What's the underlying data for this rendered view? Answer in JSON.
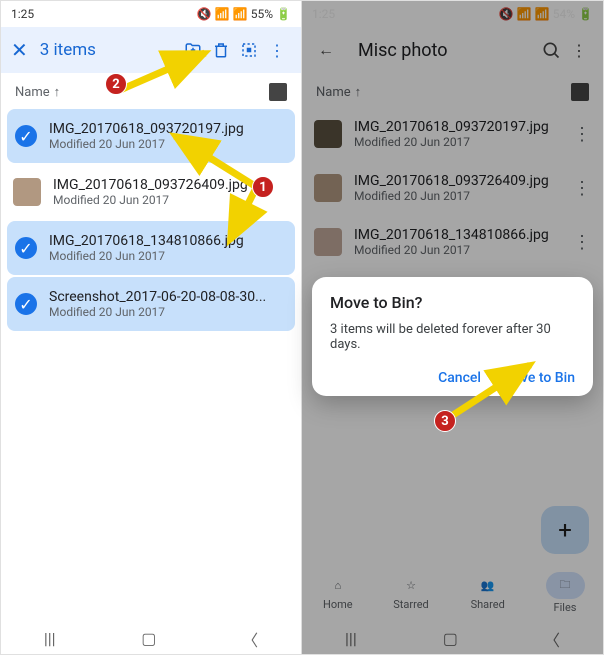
{
  "left": {
    "status": {
      "time": "1:25",
      "battery": "55%"
    },
    "topbar": {
      "title": "3 items"
    },
    "sorter": {
      "label": "Name",
      "dir": "↑"
    },
    "files": [
      {
        "name": "IMG_20170618_093720197.jpg",
        "modified": "Modified 20 Jun 2017",
        "selected": true
      },
      {
        "name": "IMG_20170618_093726409.jpg",
        "modified": "Modified 20 Jun 2017",
        "selected": false
      },
      {
        "name": "IMG_20170618_134810866.jpg",
        "modified": "Modified 20 Jun 2017",
        "selected": true
      },
      {
        "name": "Screenshot_2017-06-20-08-08-30...",
        "modified": "Modified 20 Jun 2017",
        "selected": true
      }
    ]
  },
  "right": {
    "status": {
      "time": "1:25",
      "battery": "54%"
    },
    "topbar": {
      "title": "Misc photo"
    },
    "sorter": {
      "label": "Name",
      "dir": "↑"
    },
    "files": [
      {
        "name": "IMG_20170618_093720197.jpg",
        "modified": "Modified 20 Jun 2017"
      },
      {
        "name": "IMG_20170618_093726409.jpg",
        "modified": "Modified 20 Jun 2017"
      },
      {
        "name": "IMG_20170618_134810866.jpg",
        "modified": "Modified 20 Jun 2017"
      }
    ],
    "dialog": {
      "title": "Move to Bin?",
      "body": "3 items will be deleted forever after 30 days.",
      "cancel": "Cancel",
      "confirm": "Move to Bin"
    },
    "tabs": [
      {
        "label": "Home"
      },
      {
        "label": "Starred"
      },
      {
        "label": "Shared"
      },
      {
        "label": "Files",
        "active": true
      }
    ]
  },
  "badges": {
    "b1": "1",
    "b2": "2",
    "b3": "3"
  }
}
